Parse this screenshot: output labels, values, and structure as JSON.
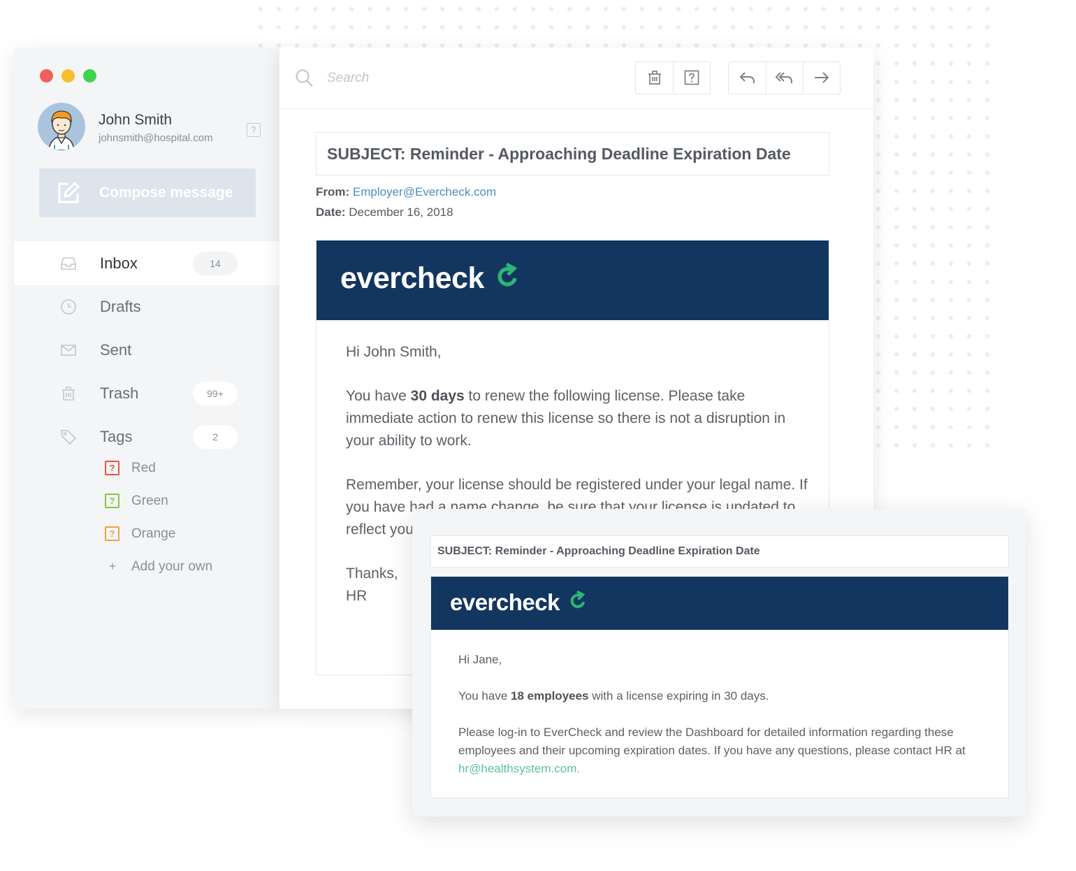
{
  "user": {
    "name": "John Smith",
    "email": "johnsmith@hospital.com"
  },
  "compose": {
    "label": "Compose message",
    "icon": "compose-icon"
  },
  "nav": [
    {
      "label": "Inbox",
      "badge": "14",
      "icon": "inbox-icon",
      "active": true
    },
    {
      "label": "Drafts",
      "badge": "",
      "icon": "clock-icon",
      "active": false
    },
    {
      "label": "Sent",
      "badge": "",
      "icon": "envelope-icon",
      "active": false
    },
    {
      "label": "Trash",
      "badge": "99+",
      "icon": "trash-icon",
      "active": false
    },
    {
      "label": "Tags",
      "badge": "2",
      "icon": "tag-icon",
      "active": false
    }
  ],
  "tags": [
    {
      "label": "Red",
      "glyph": "?",
      "color": "#e5533f"
    },
    {
      "label": "Green",
      "glyph": "?",
      "color": "#8cc63f"
    },
    {
      "label": "Orange",
      "glyph": "?",
      "color": "#f2a33a"
    }
  ],
  "add_tag": {
    "glyph": "+",
    "label": "Add your own"
  },
  "help_glyph": "?",
  "search": {
    "placeholder": "Search"
  },
  "email": {
    "subject": "SUBJECT:  Reminder - Approaching Deadline Expiration Date",
    "from_label": "From:",
    "from": "Employer@Evercheck.com",
    "date_label": "Date:",
    "date": "December 16, 2018",
    "logo": "evercheck",
    "greeting": "Hi John Smith,",
    "p1_a": "You have ",
    "p1_b": "30 days",
    "p1_c": " to renew the following license. Please take immediate action to renew this license so there is not a disruption in your ability to work.",
    "p2": "Remember, your license should be registered under your legal name. If you have had a name change, be sure that your license is updated to reflect your legal name.",
    "sign1": "Thanks,",
    "sign2": "HR"
  },
  "popup": {
    "subject": "SUBJECT:  Reminder - Approaching Deadline Expiration Date",
    "logo": "evercheck",
    "greeting": "Hi Jane,",
    "p1_a": "You have ",
    "p1_b": "18 employees",
    "p1_c": " with a license expiring in 30 days.",
    "p2_a": "Please log-in to EverCheck and review the Dashboard for detailed information regarding these employees and their upcoming expiration dates. If you have any questions, please contact HR at ",
    "p2_link": "hr@healthsystem.com."
  },
  "colors": {
    "banner": "#133660",
    "logo_accent": "#2bb673",
    "link": "#4a8ec3",
    "popup_link": "#5bc0a0"
  }
}
